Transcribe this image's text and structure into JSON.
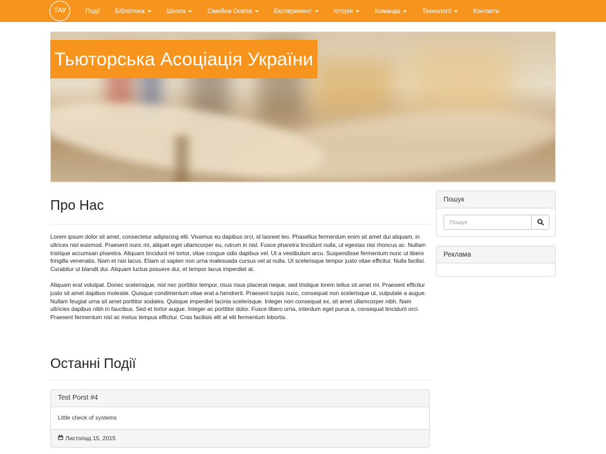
{
  "brand": {
    "logo_text": "ТАУ"
  },
  "nav": {
    "items": [
      {
        "label": "Події",
        "dropdown": false
      },
      {
        "label": "Бібліотека",
        "dropdown": true
      },
      {
        "label": "Школа",
        "dropdown": true
      },
      {
        "label": "Сімейна Освіта",
        "dropdown": true
      },
      {
        "label": "Експеримент",
        "dropdown": true
      },
      {
        "label": "Історія",
        "dropdown": true
      },
      {
        "label": "Команда",
        "dropdown": true
      },
      {
        "label": "Технології",
        "dropdown": true
      },
      {
        "label": "Контакти",
        "dropdown": false
      }
    ]
  },
  "hero": {
    "title": "Тьюторська Асоціація України",
    "slides_count": 6,
    "active_slide": 1
  },
  "about": {
    "heading": "Про Нас",
    "paragraphs": [
      "Lorem ipsum dolor sit amet, consectetur adipiscing elit. Vivamus eu dapibus orci, id laoreet leo. Phasellus fermentum enim sit amet dui aliquam, in ultrices nisl euismod. Praesent nunc mi, aliquet eget ullamcorper eu, rutrum in nisl. Fusce pharetra tincidunt nulla, ut egestas nisi rhoncus ac. Nullam tristique accumsan pharetra. Aliquam tincidunt mi tortor, vitae congue odio dapibus vel. Ut a vestibulum arcu. Suspendisse fermentum nunc ut libero fringilla venenatis. Nam et nisi lacus. Etiam ut sapien non urna malesuada cursus vel at nulla. Ut scelerisque tempor justo vitae efficitur. Nulla facilisi. Curabitur ut blandit dui. Aliquam luctus posuere dui, et tempor lacus imperdiet at.",
      "Aliquam erat volutpat. Donec scelerisque, nisl nec porttitor tempor, risus risus placerat neque, sed tristique lorem tellus sit amet mi. Praesent efficitur justo sit amet dapibus molestie. Quisque condimentum vitae erat a hendrerit. Praesent turpis nunc, consequat non scelerisque ut, vulputate a augue. Nullam feugiat urna sit amet porttitor sodales. Quisque imperdiet lacinia scelerisque. Integer non consequat ex, sit amet ullamcorper nibh. Nam ultricies dapibus nibh in faucibus. Sed et tortor augue. Integer ac porttitor dolor. Fusce libero urna, interdum eget purus a, consequat tincidunt orci. Praesent fermentum nisl ac metus tempus efficitur. Cras facilisis elit at elit fermentum lobortis."
    ]
  },
  "events": {
    "heading": "Останні Події",
    "items": [
      {
        "title": "Test Porst #4",
        "body": "Little check of systems",
        "date": "Листопад 15, 2015"
      }
    ]
  },
  "sidebar": {
    "search": {
      "title": "Пошук",
      "placeholder": "Пошук"
    },
    "ads": {
      "title": "Реклама"
    }
  },
  "colors": {
    "accent": "#f7941d",
    "panel_bg": "#f5f5f5",
    "border": "#dddddd"
  },
  "icons": {
    "search": "search-icon",
    "calendar": "calendar-icon",
    "caret": "caret-down-icon"
  }
}
